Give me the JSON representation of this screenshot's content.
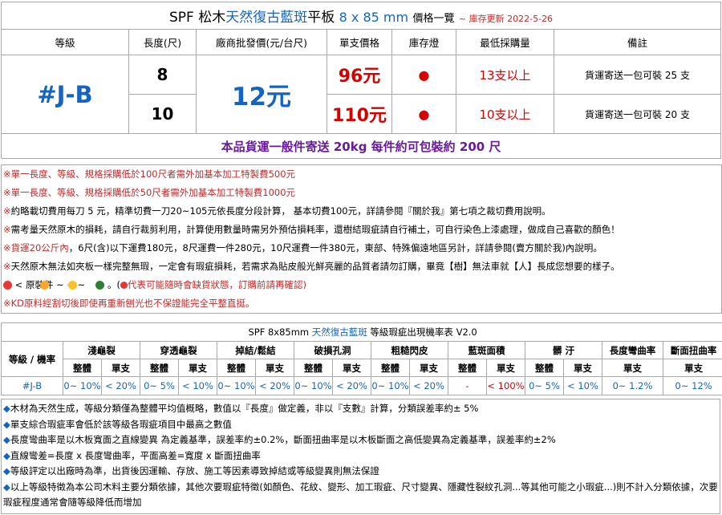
{
  "price_table": {
    "title": {
      "prefix": "SPF 松木",
      "series": "天然復古藍斑",
      "product": "平板",
      "dims": "8 x 85 mm",
      "label": "價格一覽",
      "updated": "~ 庫存更新 2022-5-26"
    },
    "headers": [
      "等級",
      "長度(尺)",
      "廠商批發價(元/台尺)",
      "單支價格",
      "庫存燈",
      "最低採購量",
      "備註"
    ],
    "code": "#J-B",
    "wholesale_price": "12元",
    "rows": [
      {
        "length": "8",
        "unit_price": "96元",
        "stock": "●",
        "min_order": "13支以上",
        "remark": "貨運寄送一包可裝 25 支"
      },
      {
        "length": "10",
        "unit_price": "110元",
        "stock": "●",
        "min_order": "10支以上",
        "remark": "貨運寄送一包可裝 20 支"
      }
    ],
    "shipping_note": "本品貨運一般件寄送 20kg 每件約可包裝約 200 尺"
  },
  "notes": [
    {
      "mark": "※",
      "text": "單一長度、等級、規格採購低於100尺者需外加基本加工特製費500元",
      "red": true
    },
    {
      "mark": "※",
      "text": "單一長度、等級、規格採購低於50尺者需外加基本加工特製費1000元",
      "red": true
    },
    {
      "mark": "※",
      "text": "約略載切費用每刀 5 元，精準切費一刀20~105元依長度分段計算， 基本切費100元，詳請參閱『關於我』第七項之裁切費用說明。",
      "red": false
    },
    {
      "mark": "※",
      "text": "需考量天然原木的損耗，請自行裁剪利用，計算使用數量時需另外預估損耗率，還樹結瑕疵請自行補土，可自行染色上漆處理，做成自己喜歡的顏色！",
      "red": false
    },
    {
      "mark": "※",
      "red_part": "貨運20公斤內",
      "text": "，6尺(含)以下運費180元，8尺運費一件280元，10尺運費一件380元，東部、特殊偏遠地區另計，詳請參閱(賣方關於我)內說明。"
    },
    {
      "mark": "※",
      "text": "天然原木無法如夾板一樣完整無瑕，一定會有瑕疵損耗，若需求為貼皮般光鮮亮麗的品質者請勿訂購，畢竟【樹】無法車就【人】長成您想要的樣子。",
      "red": false
    }
  ],
  "legend": {
    "text": "< 原裝件 ~ ~ ~",
    "colors": [
      "#e53935",
      "#ffa726",
      "#fbc02d",
      "#2e7d32"
    ],
    "note_prefix": "。(",
    "note": "代表可能隨時會缺貨狀態，訂購前請再確認)"
  },
  "kd_note": {
    "mark": "※",
    "text": "KD原料經割切後即使再重新刨光也不保證能完全平整直挺。"
  },
  "defect_table": {
    "title_prefix": "SPF 8x85mm ",
    "title_series": "天然復古藍斑",
    "title_suffix": " 等級瑕疵出現機率表 V2.0",
    "grade_header": "等級 / 機率",
    "groups": [
      "淺龜裂",
      "穿透龜裂",
      "掉結/鬆結",
      "破損孔洞",
      "粗糙閃皮",
      "藍斑面積",
      "髒 汙"
    ],
    "group_sub": [
      "整體",
      "單支"
    ],
    "extra_headers": [
      "長度彎曲率",
      "斷面扭曲率"
    ],
    "extra_sub": [
      "單支",
      "單支"
    ],
    "row": {
      "grade": "#J-B",
      "values": [
        "0~ 10%",
        "< 20%",
        "0~ 5%",
        "< 10%",
        "0~ 10%",
        "< 20%",
        "0~ 10%",
        "< 20%",
        "0~ 10%",
        "< 20%",
        "-",
        "< 100%",
        "0~ 5%",
        "< 10%",
        "0~ 1.2%",
        "0~ 12%"
      ]
    }
  },
  "footer_notes": [
    "木材為天然生成，等級分類僅為整體平均值概略，數值以『長度』做定義，非以『支數』計算，分類誤差率約± 5%",
    "單支綜合瑕疵率會低於該等級各瑕疵項目中最高之數值",
    "長度彎曲率是以木板寬面之直線變異 為定義基準，誤差率約±0.2%，斷面扭曲率是以木板斷面之高低變異為定義基準，誤差率約±2%",
    "直線彎差=長度 x 長度彎曲率，平面高差=寬度 x 斷面扭曲率",
    "等級評定以出廠時為準，出貨後因運輸、存放、施工等因素導致掉結或等級變異則無法保證",
    "以上等級特徵為本公司木料主要分類依據，其他次要瑕疵特徵(如顏色、花紋、變形、加工瑕疵、尺寸變異、隱藏性裂紋孔洞...等其他可能之小瑕疵...)則不計入分類依據，次要瑕疵程度通常會隨等級降低而增加"
  ],
  "colors": {
    "blue": "#1565c0",
    "red": "#d50000",
    "purple": "#6a1b9a",
    "border": "#a9a9a9"
  }
}
